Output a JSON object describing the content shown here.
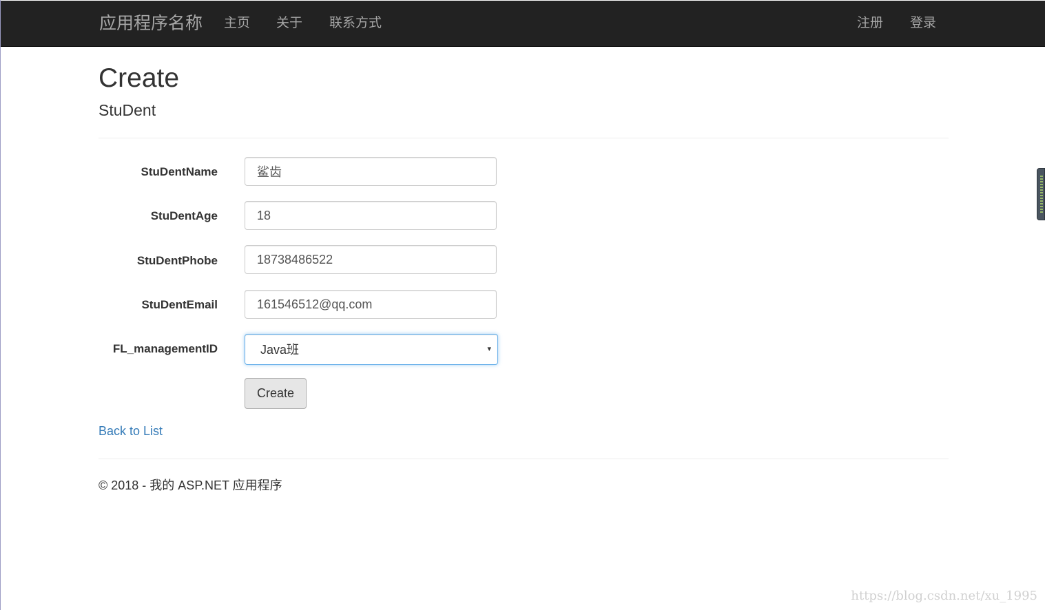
{
  "navbar": {
    "brand": "应用程序名称",
    "links": [
      "主页",
      "关于",
      "联系方式"
    ],
    "right_links": [
      "注册",
      "登录"
    ]
  },
  "page": {
    "title": "Create",
    "subtitle": "StuDent"
  },
  "form": {
    "fields": [
      {
        "label": "StuDentName",
        "value": "鲨齿"
      },
      {
        "label": "StuDentAge",
        "value": "18"
      },
      {
        "label": "StuDentPhobe",
        "value": "18738486522"
      },
      {
        "label": "StuDentEmail",
        "value": "161546512@qq.com"
      }
    ],
    "select": {
      "label": "FL_managementID",
      "value": "Java班",
      "caret": "▾"
    },
    "submit_label": "Create"
  },
  "back_link": "Back to List",
  "footer": "© 2018 - 我的 ASP.NET 应用程序",
  "watermark": "https://blog.csdn.net/xu_1995",
  "colors": {
    "navbar_bg": "#222222",
    "nav_text": "#a6a6a6",
    "link": "#337ab7",
    "focus_border": "#66afe9"
  }
}
